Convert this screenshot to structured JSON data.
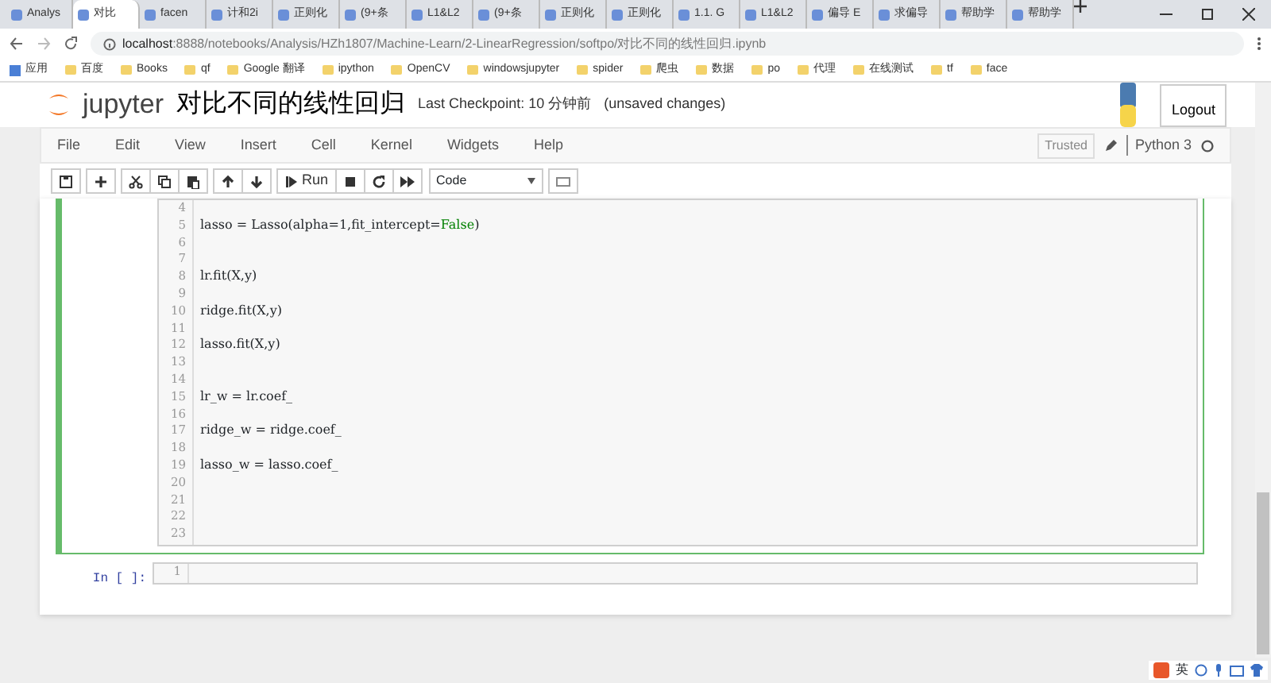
{
  "browser": {
    "tabs": [
      {
        "label": "Analys",
        "selected": false
      },
      {
        "label": "对比",
        "selected": true
      },
      {
        "label": "facen",
        "selected": false
      },
      {
        "label": "计和2i",
        "selected": false
      },
      {
        "label": "正则化",
        "selected": false
      },
      {
        "label": "(9+条",
        "selected": false
      },
      {
        "label": "L1&L2",
        "selected": false
      },
      {
        "label": "(9+条",
        "selected": false
      },
      {
        "label": "正则化",
        "selected": false
      },
      {
        "label": "正则化",
        "selected": false
      },
      {
        "label": "1.1. G",
        "selected": false
      },
      {
        "label": "L1&L2",
        "selected": false
      },
      {
        "label": "偏导 E",
        "selected": false
      },
      {
        "label": "求偏导",
        "selected": false
      },
      {
        "label": "帮助学",
        "selected": false
      },
      {
        "label": "帮助学",
        "selected": false
      }
    ],
    "url_host": "localhost",
    "url_rest": ":8888/notebooks/Analysis/HZh1807/Machine-Learn/2-LinearRegression/softpo/对比不同的线性回归.ipynb",
    "bookmarks": [
      "应用",
      "百度",
      "Books",
      "qf",
      "Google 翻译",
      "ipython",
      "OpenCV",
      "windowsjupyter",
      "spider",
      "爬虫",
      "数据",
      "po",
      "代理",
      "在线测试",
      "tf",
      "face"
    ]
  },
  "notebook": {
    "logo_text": "jupyter",
    "title": "对比不同的线性回归",
    "checkpoint": "Last Checkpoint: 10 分钟前",
    "unsaved": "(unsaved changes)",
    "logout": "Logout",
    "menu": [
      "File",
      "Edit",
      "View",
      "Insert",
      "Cell",
      "Kernel",
      "Widgets",
      "Help"
    ],
    "trusted": "Trusted",
    "kernel": "Python 3",
    "run_label": "Run",
    "cell_type": "Code"
  },
  "cells": [
    {
      "selected": true,
      "lines": [
        {
          "number": "4"
        },
        {
          "number": "5",
          "tokens": [
            {
              "text": "lasso = Lasso(alpha=1,fit_intercept=",
              "kind": "plain"
            },
            {
              "text": "False",
              "kind": "keyword"
            },
            {
              "text": ")",
              "kind": "plain"
            }
          ]
        },
        {
          "number": "6"
        },
        {
          "number": "7"
        },
        {
          "number": "8",
          "tokens": [
            {
              "text": "lr.fit(X,y)",
              "kind": "plain"
            }
          ]
        },
        {
          "number": "9"
        },
        {
          "number": "10",
          "tokens": [
            {
              "text": "ridge.fit(X,y)",
              "kind": "plain"
            }
          ]
        },
        {
          "number": "11"
        },
        {
          "number": "12",
          "tokens": [
            {
              "text": "lasso.fit(X,y)",
              "kind": "plain"
            }
          ]
        },
        {
          "number": "13"
        },
        {
          "number": "14"
        },
        {
          "number": "15",
          "tokens": [
            {
              "text": "lr_w = lr.coef_",
              "kind": "plain"
            }
          ]
        },
        {
          "number": "16"
        },
        {
          "number": "17",
          "tokens": [
            {
              "text": "ridge_w = ridge.coef_",
              "kind": "plain"
            }
          ]
        },
        {
          "number": "18"
        },
        {
          "number": "19",
          "tokens": [
            {
              "text": "lasso_w = lasso.coef_",
              "kind": "plain"
            }
          ]
        },
        {
          "number": "20"
        },
        {
          "number": "21"
        },
        {
          "number": "22"
        },
        {
          "number": "23"
        }
      ]
    },
    {
      "selected": false,
      "prompt": "In [ ]:",
      "lines": [
        {
          "number": "1"
        }
      ]
    }
  ],
  "ime": {
    "label": "英"
  }
}
